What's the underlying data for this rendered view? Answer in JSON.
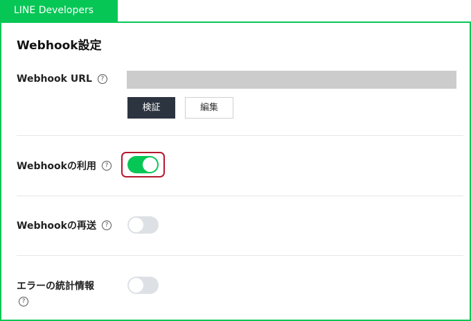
{
  "header": {
    "brand_tab": "LINE Developers"
  },
  "section": {
    "title": "Webhook設定"
  },
  "webhook_url": {
    "label": "Webhook URL",
    "value": "",
    "verify_button": "検証",
    "edit_button": "編集"
  },
  "use_webhook": {
    "label": "Webhookの利用",
    "enabled": true
  },
  "redelivery": {
    "label": "Webhookの再送",
    "enabled": false
  },
  "error_stats": {
    "label": "エラーの統計情報",
    "enabled": false
  },
  "help_glyph": "?",
  "colors": {
    "brand": "#06c755",
    "highlight": "#b5162c",
    "toggle_off": "#dde0e4",
    "button_dark": "#2c3440"
  }
}
